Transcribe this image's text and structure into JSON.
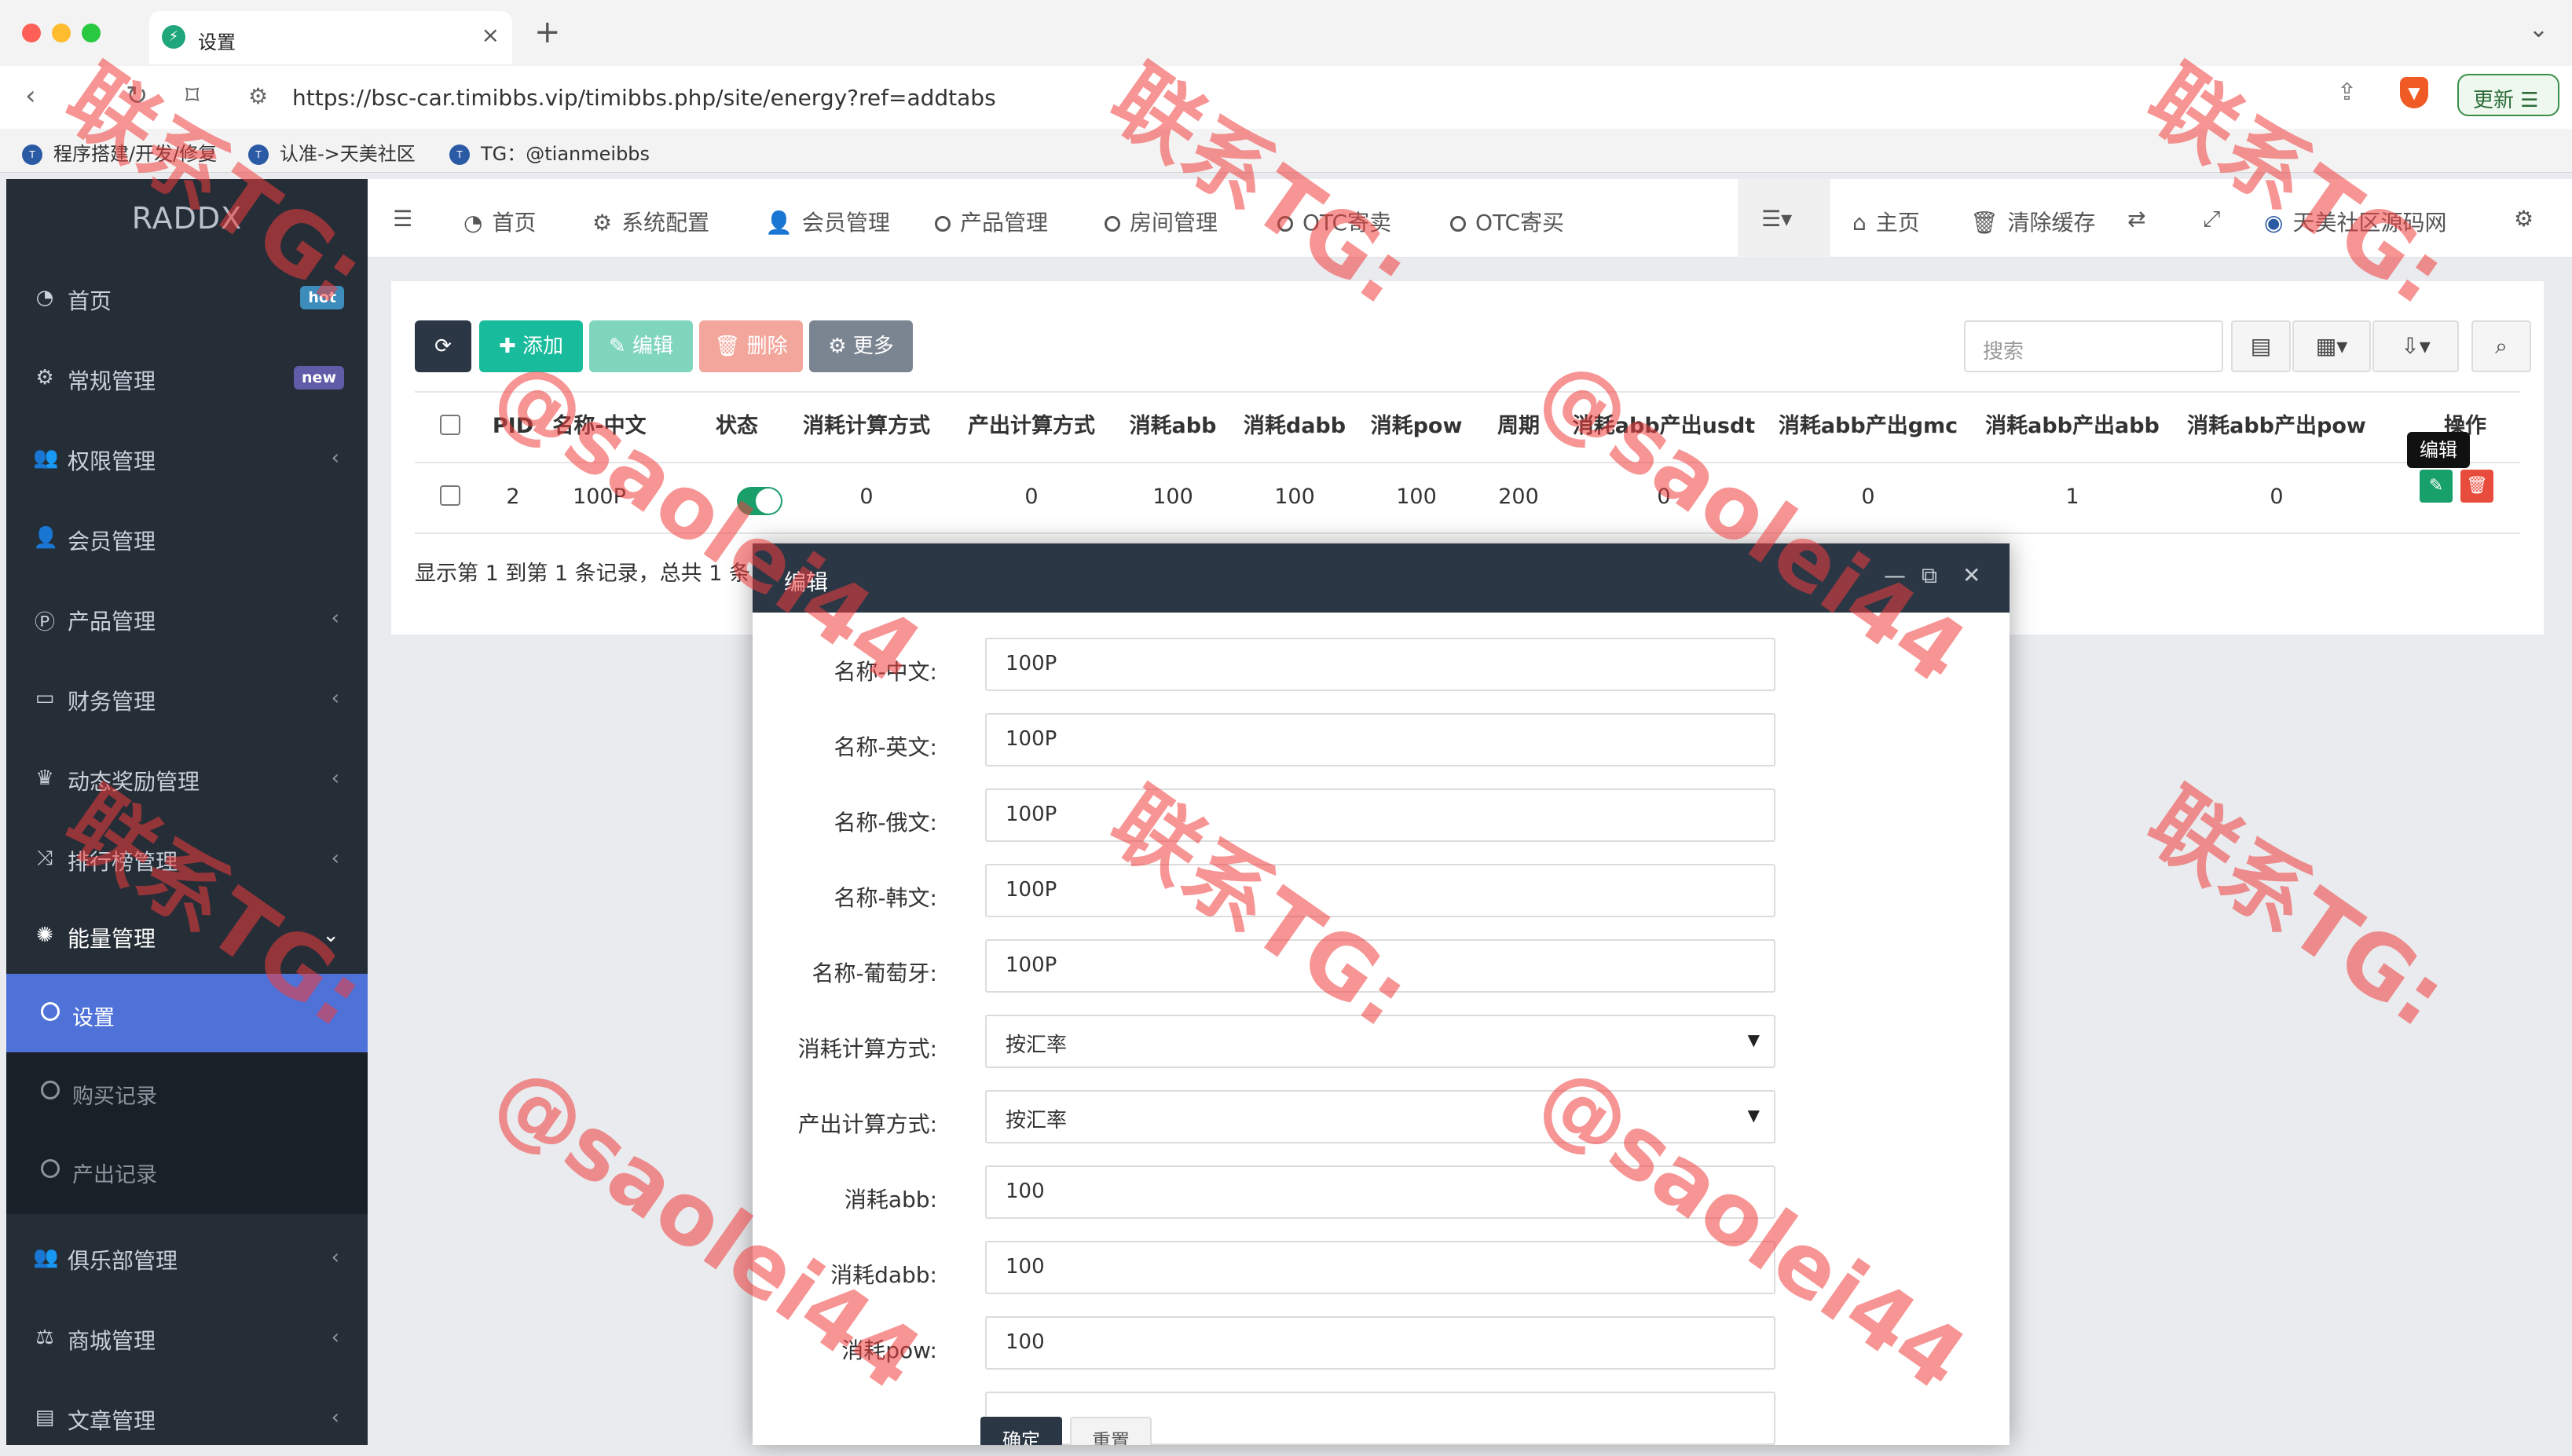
{
  "browser": {
    "tab_title": "设置",
    "tab_close": "×",
    "new_tab": "+",
    "url": "https://bsc-car.timibbs.vip/timibbs.php/site/energy?ref=addtabs",
    "update_label": "更新 ☰",
    "bookmarks": [
      "程序搭建/开发/修复",
      "认准->天美社区",
      "TG：@tianmeibbs"
    ]
  },
  "sidebar": {
    "logo": "RADDX",
    "items": [
      {
        "label": "首页",
        "icon": "dashboard-icon",
        "badge": "hot"
      },
      {
        "label": "常规管理",
        "icon": "cogs-icon",
        "badge": "new"
      },
      {
        "label": "权限管理",
        "icon": "users-icon"
      },
      {
        "label": "会员管理",
        "icon": "user-icon"
      },
      {
        "label": "产品管理",
        "icon": "product-icon"
      },
      {
        "label": "财务管理",
        "icon": "card-icon"
      },
      {
        "label": "动态奖励管理",
        "icon": "reward-icon"
      },
      {
        "label": "排行榜管理",
        "icon": "shuffle-icon"
      },
      {
        "label": "能量管理",
        "icon": "energy-icon"
      },
      {
        "label": "俱乐部管理",
        "icon": "club-icon"
      },
      {
        "label": "商城管理",
        "icon": "scale-icon"
      },
      {
        "label": "文章管理",
        "icon": "article-icon"
      }
    ],
    "submenu": [
      "设置",
      "购买记录",
      "产出记录"
    ],
    "badge_colors": {
      "hot": "#3c8dbc",
      "new": "#605ca8"
    }
  },
  "topnav": {
    "items": [
      "首页",
      "系统配置",
      "会员管理",
      "产品管理",
      "房间管理",
      "OTC寄卖",
      "OTC寄买"
    ],
    "right": [
      "主页",
      "清除缓存",
      "天美社区源码网"
    ]
  },
  "toolbar": {
    "add": "添加",
    "edit": "编辑",
    "delete": "删除",
    "more": "更多",
    "search_placeholder": "搜索"
  },
  "table": {
    "headers": [
      "PID",
      "名称-中文",
      "状态",
      "消耗计算方式",
      "产出计算方式",
      "消耗abb",
      "消耗dabb",
      "消耗pow",
      "周期",
      "消耗abb产出usdt",
      "消耗abb产出gmc",
      "消耗abb产出abb",
      "消耗abb产出pow",
      "操作"
    ],
    "row": {
      "pid": "2",
      "name": "100P",
      "consume_mode": "0",
      "output_mode": "0",
      "abb": "100",
      "dabb": "100",
      "pow": "100",
      "period": "200",
      "usdt": "0",
      "gmc": "0",
      "out_abb": "1",
      "out_pow": "0"
    },
    "tooltip": "编辑",
    "footer": "显示第 1 到第 1 条记录，总共 1 条"
  },
  "modal": {
    "title": "编辑",
    "fields": [
      {
        "label": "名称-中文:",
        "value": "100P"
      },
      {
        "label": "名称-英文:",
        "value": "100P"
      },
      {
        "label": "名称-俄文:",
        "value": "100P"
      },
      {
        "label": "名称-韩文:",
        "value": "100P"
      },
      {
        "label": "名称-葡萄牙:",
        "value": "100P"
      },
      {
        "label": "消耗计算方式:",
        "value": "按汇率"
      },
      {
        "label": "产出计算方式:",
        "value": "按汇率"
      },
      {
        "label": "消耗abb:",
        "value": "100"
      },
      {
        "label": "消耗dabb:",
        "value": "100"
      },
      {
        "label": "消耗pow:",
        "value": "100"
      }
    ],
    "confirm": "确定",
    "reset": "重置"
  },
  "watermark": {
    "line1": "联系TG:",
    "line2": "@saolei44"
  }
}
